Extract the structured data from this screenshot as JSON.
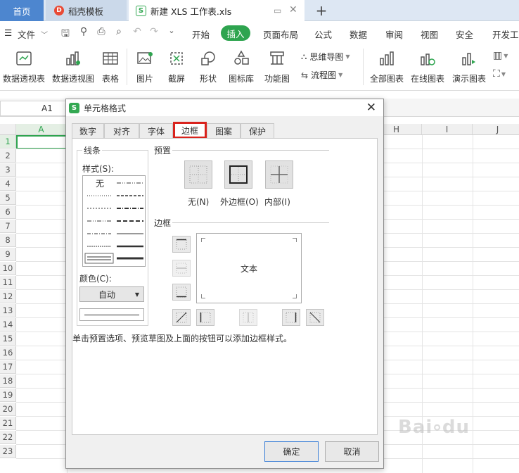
{
  "tabs": {
    "home": "首页",
    "daoke": "稻壳模板",
    "file": "新建 XLS 工作表.xls",
    "add": "+"
  },
  "menubar": {
    "file": "文件",
    "items": [
      "开始",
      "插入",
      "页面布局",
      "公式",
      "数据",
      "审阅",
      "视图",
      "安全",
      "开发工"
    ],
    "active": "插入"
  },
  "ribbon": {
    "big": [
      "数据透视表",
      "数据透视图",
      "表格",
      "图片",
      "截屏",
      "形状",
      "图标库",
      "功能图",
      "全部图表",
      "在线图表",
      "演示图表"
    ],
    "small": [
      "思维导图",
      "流程图"
    ]
  },
  "namebox": "A1",
  "grid": {
    "cols": [
      "A",
      "H",
      "I",
      "J"
    ],
    "rows": [
      "1",
      "2",
      "3",
      "4",
      "5",
      "6",
      "7",
      "8",
      "9",
      "10",
      "11",
      "12",
      "13",
      "14",
      "15",
      "16",
      "17",
      "18",
      "19",
      "20",
      "21",
      "22",
      "23"
    ]
  },
  "dialog": {
    "title": "单元格格式",
    "tabs": [
      "数字",
      "对齐",
      "字体",
      "边框",
      "图案",
      "保护"
    ],
    "active_tab": "边框",
    "line_group": "线条",
    "style_label": "样式(S):",
    "style_none": "无",
    "color_label": "颜色(C):",
    "color_value": "自动",
    "preset_group": "预置",
    "presets": [
      "无(N)",
      "外边框(O)",
      "内部(I)"
    ],
    "border_group": "边框",
    "preview_text": "文本",
    "hint": "单击预置选项、预览草图及上面的按钮可以添加边框样式。",
    "ok": "确定",
    "cancel": "取消"
  },
  "colors": {
    "accent_green": "#2ea44f",
    "home_tab": "#4d86cf",
    "highlight": "#d9231d"
  }
}
